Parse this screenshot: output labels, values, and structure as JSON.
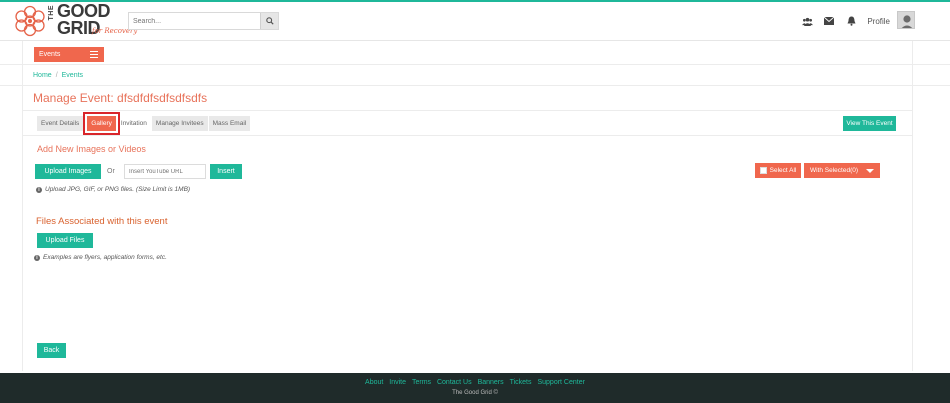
{
  "header": {
    "logo": {
      "the": "THE",
      "good": "GOOD",
      "grid": "GRID",
      "sub": "for Recovery"
    },
    "search": {
      "placeholder": "Search..."
    },
    "icons": [
      "users-icon",
      "envelope-icon",
      "bell-icon"
    ],
    "profile_label": "Profile"
  },
  "nav": {
    "events_label": "Events"
  },
  "breadcrumb": {
    "home": "Home",
    "sep": "/",
    "current": "Events"
  },
  "page_title": "Manage Event: dfsdfdfsdfsdfsdfs",
  "tabs": [
    {
      "label": "Event Details"
    },
    {
      "label": "Gallery"
    },
    {
      "label": "Invitation"
    },
    {
      "label": "Manage Invitees"
    },
    {
      "label": "Mass Email"
    }
  ],
  "view_event_label": "View This Event",
  "media": {
    "heading": "Add New Images or Videos",
    "upload_images_label": "Upload Images",
    "or_label": "Or",
    "youtube_placeholder": "Insert YouTube URL",
    "insert_label": "Insert",
    "note": "Upload JPG, GIF, or PNG files.  (Size Limit is 1MB)",
    "select_all_label": "Select All",
    "with_selected_label": "With Selected(0)"
  },
  "files": {
    "heading": "Files Associated with this event",
    "upload_files_label": "Upload Files",
    "note": "Examples are flyers, application forms, etc."
  },
  "back_label": "Back",
  "footer": {
    "links": [
      "About",
      "Invite",
      "Terms",
      "Contact Us",
      "Banners",
      "Tickets",
      "Support Center"
    ],
    "copyright": "The Good Grid ©"
  },
  "colors": {
    "brand_coral": "#f0674d",
    "brand_teal": "#1fb89a",
    "footer_bg": "#1f2b2a",
    "highlight_red": "#d9252a"
  }
}
